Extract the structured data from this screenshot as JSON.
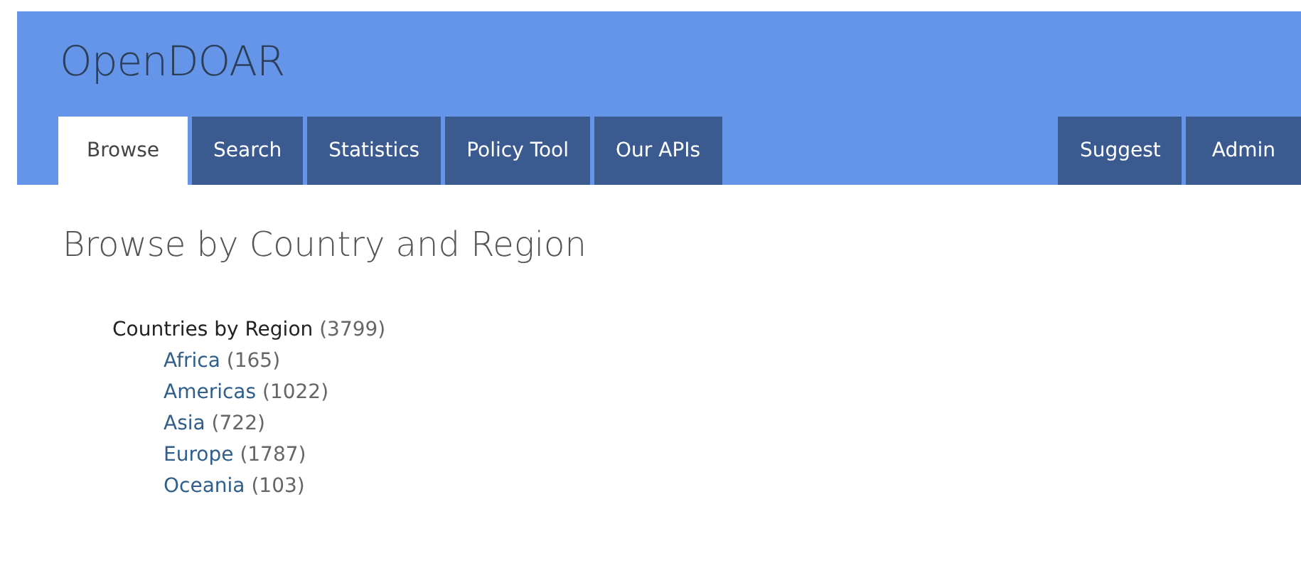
{
  "site_title": "OpenDOAR",
  "nav_tabs": [
    {
      "label": "Browse",
      "selected": true
    },
    {
      "label": "Search",
      "selected": false
    },
    {
      "label": "Statistics",
      "selected": false
    },
    {
      "label": "Policy Tool",
      "selected": false
    },
    {
      "label": "Our APIs",
      "selected": false
    }
  ],
  "nav_tabs_right": [
    {
      "label": "Suggest",
      "selected": false
    },
    {
      "label": "Admin",
      "selected": false
    }
  ],
  "heading": "Browse by Country and Region",
  "tree": {
    "label": "Countries by Region",
    "count": "(3799)",
    "children": [
      {
        "label": "Africa",
        "count": "(165)"
      },
      {
        "label": "Americas",
        "count": "(1022)"
      },
      {
        "label": "Asia",
        "count": "(722)"
      },
      {
        "label": "Europe",
        "count": "(1787)"
      },
      {
        "label": "Oceania",
        "count": "(103)"
      }
    ]
  }
}
